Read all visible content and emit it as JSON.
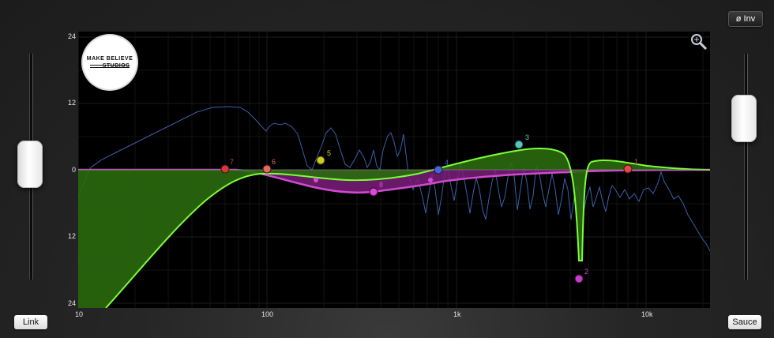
{
  "buttons": {
    "invert_label": "ø Inv",
    "link_label": "Link",
    "sauce_label": "Sauce"
  },
  "logo": {
    "line1": "MAKE BELIEVE",
    "line2": "STUDIOS"
  },
  "y_axis": {
    "labels": [
      "24",
      "12",
      "0",
      "12",
      "24"
    ]
  },
  "x_axis": {
    "labels": [
      "10",
      "100",
      "1k",
      "10k"
    ]
  },
  "bands": [
    {
      "label": "1",
      "color": "#e34a4a"
    },
    {
      "label": "2",
      "color": "#c83cc8"
    },
    {
      "label": "3",
      "color": "#5bc1c1"
    },
    {
      "label": "4",
      "color": "#4a62d4"
    },
    {
      "label": "5",
      "color": "#cccc22"
    },
    {
      "label": "6",
      "color": "#e06a6a"
    },
    {
      "label": "7",
      "color": "#d43a3a"
    },
    {
      "label": "8",
      "color": "#d84ad8"
    }
  ],
  "colors": {
    "green_curve": "#7cff3a",
    "green_fill": "#2a6a0e",
    "magenta_curve": "#d04ad0",
    "magenta_fill": "#7a1f7a",
    "spectrum": "#3a5fa8"
  }
}
